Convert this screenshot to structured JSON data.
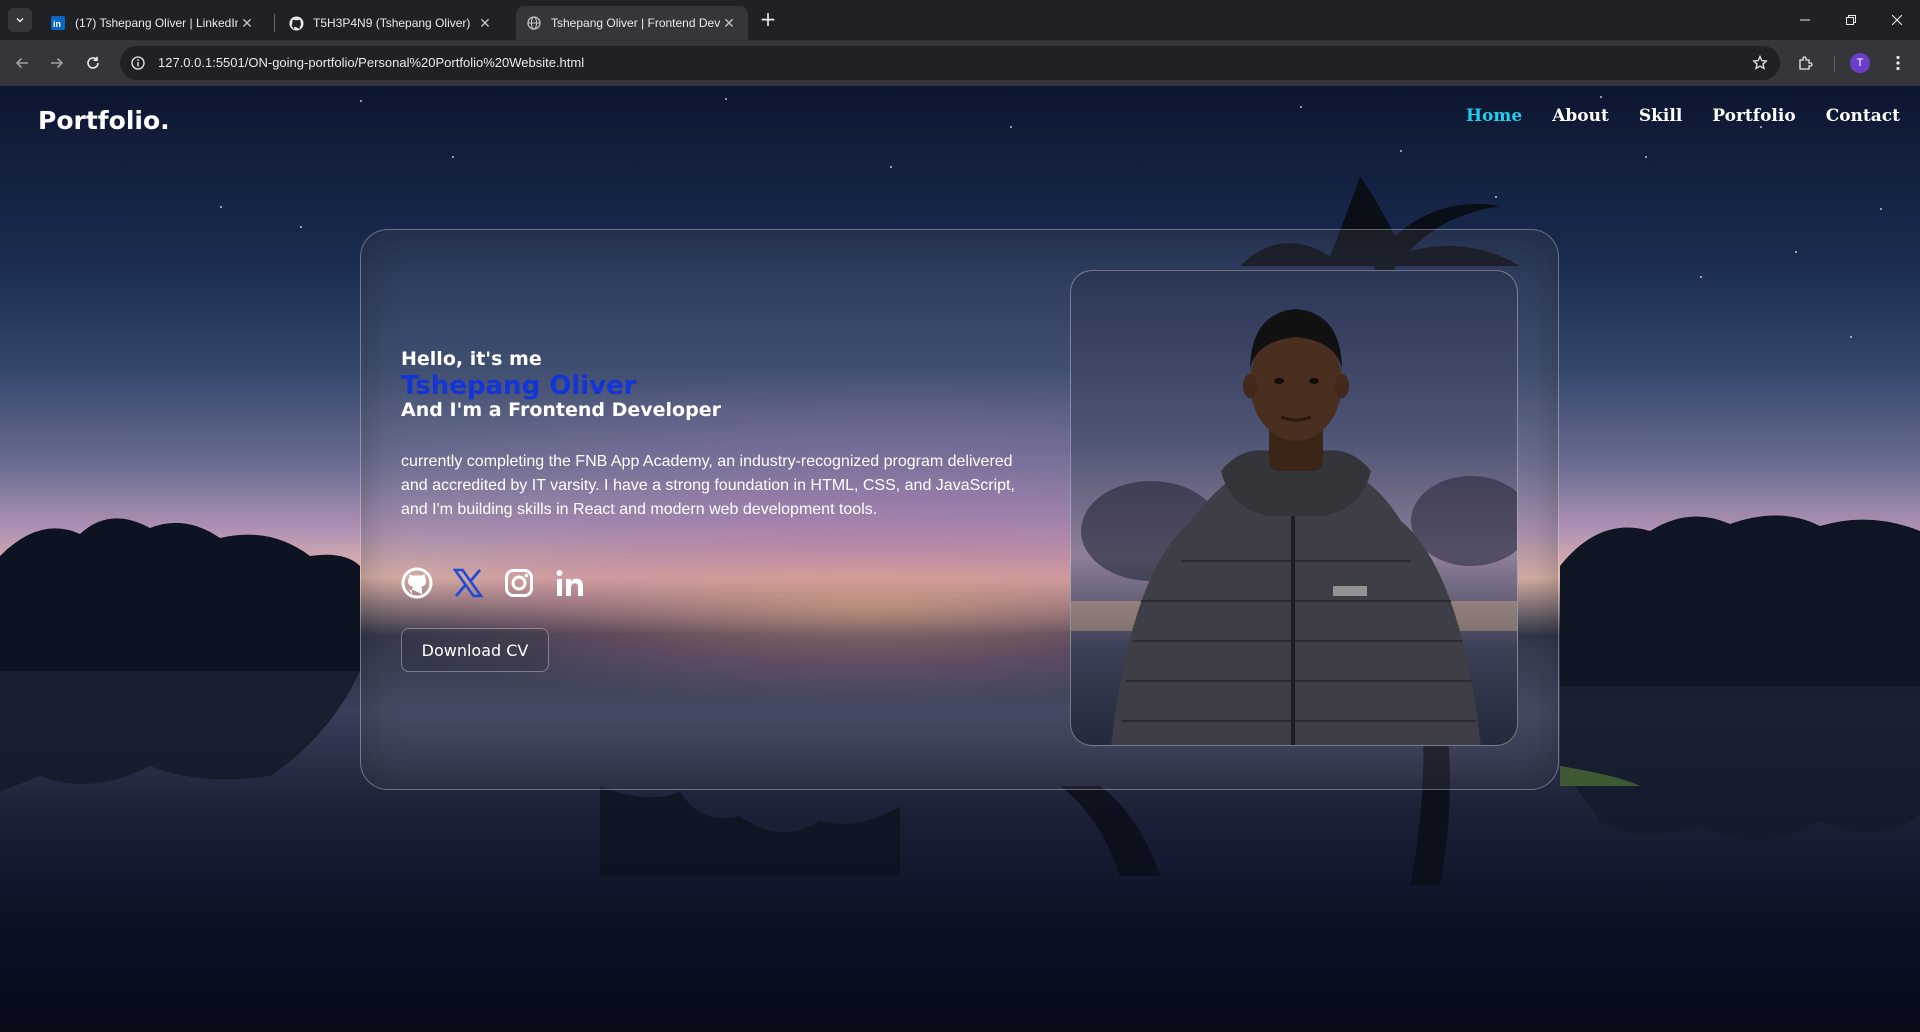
{
  "browser": {
    "tabs": [
      {
        "title": "(17) Tshepang Oliver | LinkedIn",
        "favicon": "linkedin-icon",
        "active": false
      },
      {
        "title": "T5H3P4N9 (Tshepang Oliver)",
        "favicon": "github-icon",
        "active": false
      },
      {
        "title": "Tshepang Oliver | Frontend Dev",
        "favicon": "globe-icon",
        "active": true
      }
    ],
    "new_tab": "+",
    "url": "127.0.0.1:5501/ON-going-portfolio/Personal%20Portfolio%20Website.html",
    "profile_initial": "T"
  },
  "page": {
    "logo": "Portfolio.",
    "nav": [
      "Home",
      "About",
      "Skill",
      "Portfolio",
      "Contact"
    ],
    "active_nav": "Home",
    "hero": {
      "greeting": "Hello, it's me",
      "name": "Tshepang Oliver",
      "role": "And I'm a Frontend Developer",
      "description": "currently completing the FNB App Academy, an industry-recognized program delivered and accredited by IT varsity. I have a strong foundation in HTML, CSS, and JavaScript, and I'm building skills in React and modern web development tools.",
      "socials": [
        "github-icon",
        "x-icon",
        "instagram-icon",
        "linkedin-icon"
      ],
      "cta": "Download CV"
    },
    "colors": {
      "accent_nav": "#1ed0f0",
      "name_blue": "#1334d6"
    }
  }
}
